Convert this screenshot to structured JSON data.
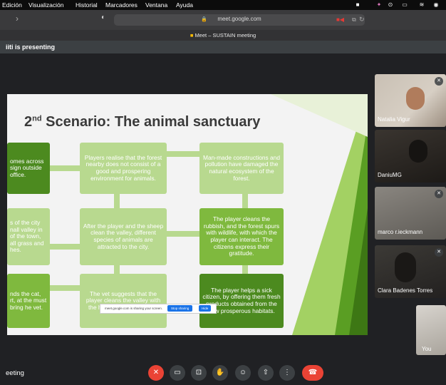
{
  "menubar": {
    "items": [
      "Edición",
      "Visualización",
      "Historial",
      "Marcadores",
      "Ventana",
      "Ayuda"
    ],
    "status_icons": [
      "camera-icon",
      "dropbox-icon",
      "play-icon",
      "battery-icon",
      "wifi-icon",
      "control-center-icon"
    ]
  },
  "browser": {
    "url": "meet.google.com",
    "tab_title": "Meet – SUSTAIN meeting"
  },
  "meet": {
    "presenting_text": "iiti is presenting",
    "meeting_name": "eeting"
  },
  "slide": {
    "title_prefix": "2",
    "title_sup": "nd",
    "title_rest": " Scenario: The animal sanctuary",
    "boxes": {
      "r1c1": "omes across sign outside office.",
      "r1c2": "Players realise that the forest nearby does not consist of a good and prospering environment for animals.",
      "r1c3": "Man-made constructions and pollution have damaged the natural ecosystem of the forest.",
      "r2c1": "s of the city nall valley in of the town, all grass and hes.",
      "r2c2": "After the player and the sheep clean the valley, different species of animals are attracted to the city.",
      "r2c3": "The player cleans the rubbish, and the forest spurs with wildlife, with which the player can interact. The citizens express their gratitude.",
      "r3c1": "nds the cat, rt, at the must bring he vet.",
      "r3c2": "The vet suggests that the player cleans the valley with the help of a sheep. office.",
      "r3c3": "The player helps a sick citizen, by offering them fresh products obtained from the new prosperous habitats."
    },
    "share_notice": {
      "text": "meet.google.com is sharing your screen.",
      "stop_label": "Stop sharing",
      "hide_label": "Hide"
    }
  },
  "participants": [
    {
      "name": "Natalia Vigur"
    },
    {
      "name": "DaniuMG"
    },
    {
      "name": "marco r.ieckmann"
    },
    {
      "name": "Clara Badenes Torres"
    },
    {
      "name": "You"
    }
  ],
  "controls": [
    "mic-off-icon",
    "camera-icon",
    "captions-icon",
    "raise-hand-icon",
    "emoji-icon",
    "present-icon",
    "more-options-icon",
    "end-call-icon"
  ],
  "colors": {
    "slide_green_dark": "#4c8a1f",
    "slide_green_mid": "#7fb93e",
    "slide_green_light": "#b8d98f",
    "end_call": "#ea4335"
  }
}
